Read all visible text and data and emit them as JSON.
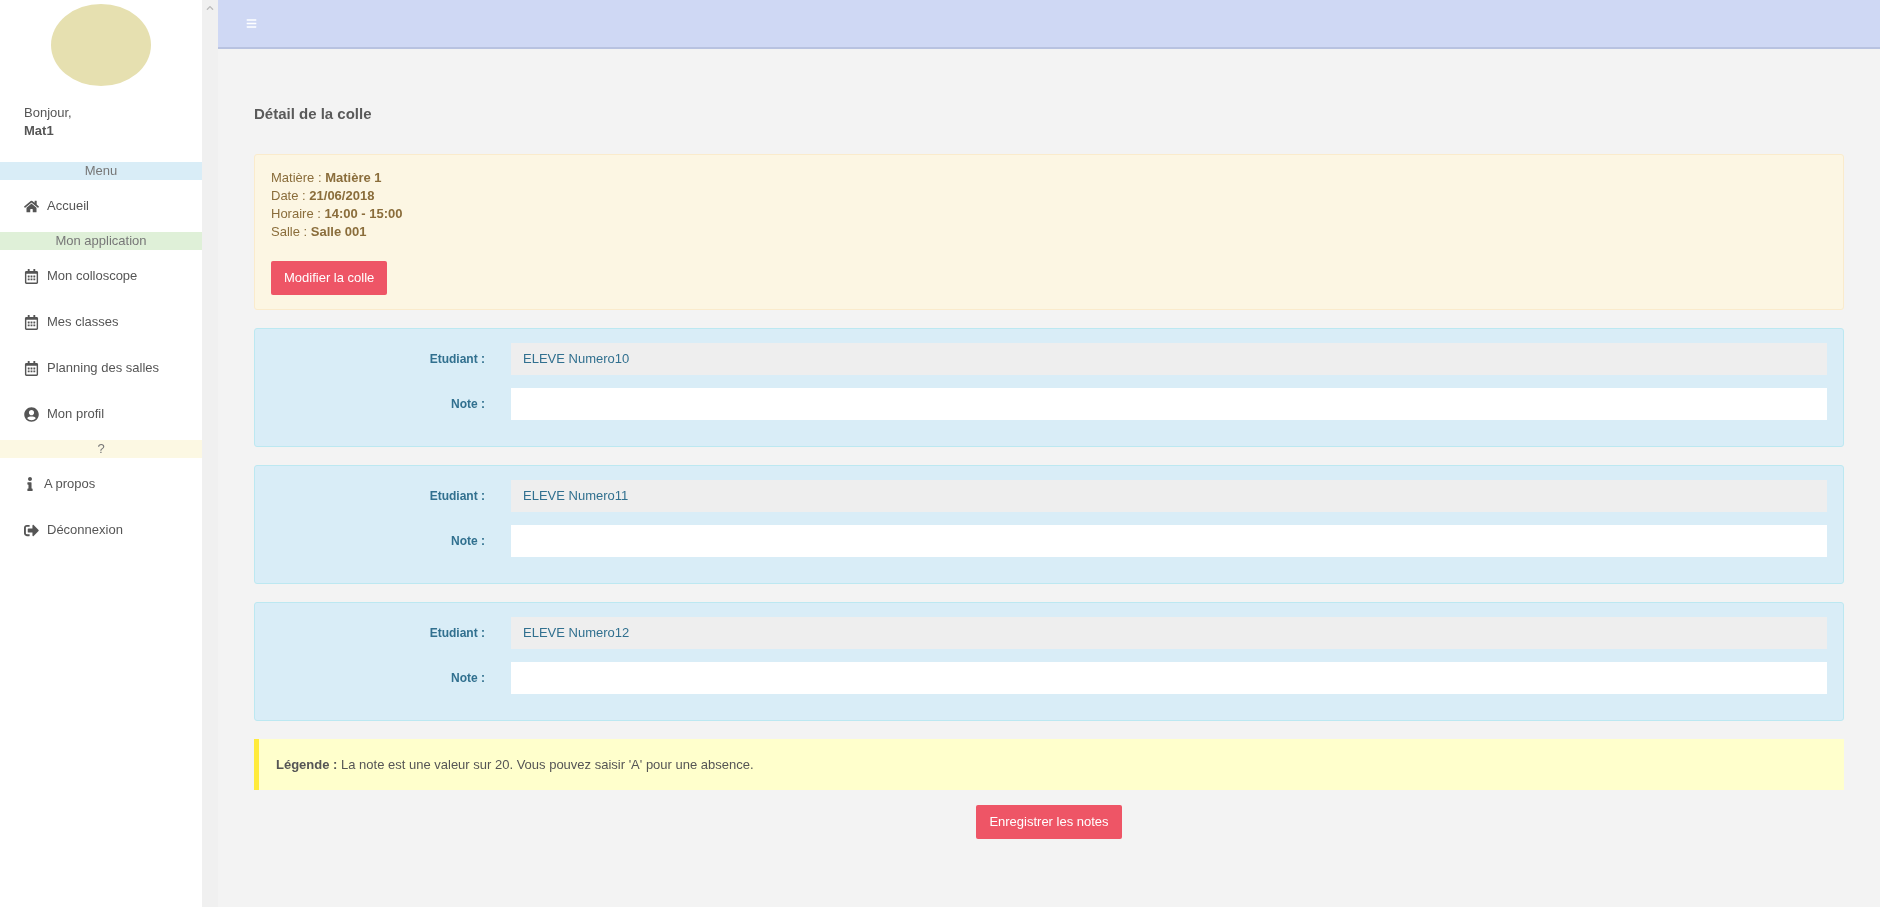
{
  "sidebar": {
    "greeting": "Bonjour,",
    "user": "Mat1",
    "sections": [
      {
        "title": "Menu",
        "color": "#d9edf7",
        "items": [
          {
            "kind": "home",
            "label": "Accueil"
          }
        ]
      },
      {
        "title": "Mon application",
        "color": "#dff0d8",
        "items": [
          {
            "kind": "calendar",
            "label": "Mon colloscope"
          },
          {
            "kind": "calendar",
            "label": "Mes classes"
          },
          {
            "kind": "calendar",
            "label": "Planning des salles"
          },
          {
            "kind": "user",
            "label": "Mon profil"
          }
        ]
      },
      {
        "title": "?",
        "color": "#fcf8e3",
        "items": [
          {
            "kind": "info",
            "label": "A propos"
          },
          {
            "kind": "logout",
            "label": "Déconnexion"
          }
        ]
      }
    ]
  },
  "main": {
    "title": "Détail de la colle",
    "details": [
      {
        "label": "Matière :",
        "value": "Matière 1"
      },
      {
        "label": "Date :",
        "value": "21/06/2018"
      },
      {
        "label": "Horaire :",
        "value": "14:00 - 15:00"
      },
      {
        "label": "Salle :",
        "value": "Salle 001"
      }
    ],
    "edit_button": "Modifier la colle",
    "students": [
      {
        "student_label": "Etudiant :",
        "student": "ELEVE Numero10",
        "note_label": "Note :"
      },
      {
        "student_label": "Etudiant :",
        "student": "ELEVE Numero11",
        "note_label": "Note :"
      },
      {
        "student_label": "Etudiant :",
        "student": "ELEVE Numero12",
        "note_label": "Note :"
      }
    ],
    "legend": "**Légende :** La note est une valeur sur 20. Vous pouvez saisir 'A' pour une absence.",
    "save_button": "Enregistrer les notes"
  }
}
